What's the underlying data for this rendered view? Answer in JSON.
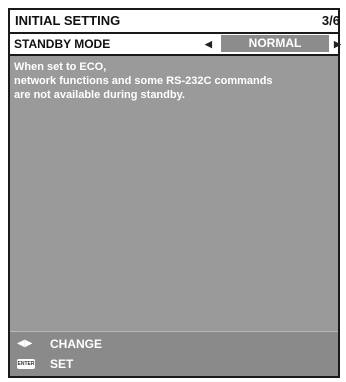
{
  "menu": {
    "title": "INITIAL SETTING",
    "page": "3/6"
  },
  "setting": {
    "label": "STANDBY MODE",
    "value": "NORMAL",
    "left_arrow_icon": "triangle-left",
    "right_arrow_icon": "triangle-right"
  },
  "message": {
    "lines": [
      "When set to ECO,",
      "network functions and some RS-232C commands",
      "are not available during standby."
    ]
  },
  "guide": {
    "change_label": "CHANGE",
    "set_label": "SET",
    "enter_key_text": "ENTER"
  },
  "colors": {
    "panel_bg": "#9a9a9a",
    "value_bg": "#8c8c8c",
    "footer_bg": "#8a8a8a"
  }
}
